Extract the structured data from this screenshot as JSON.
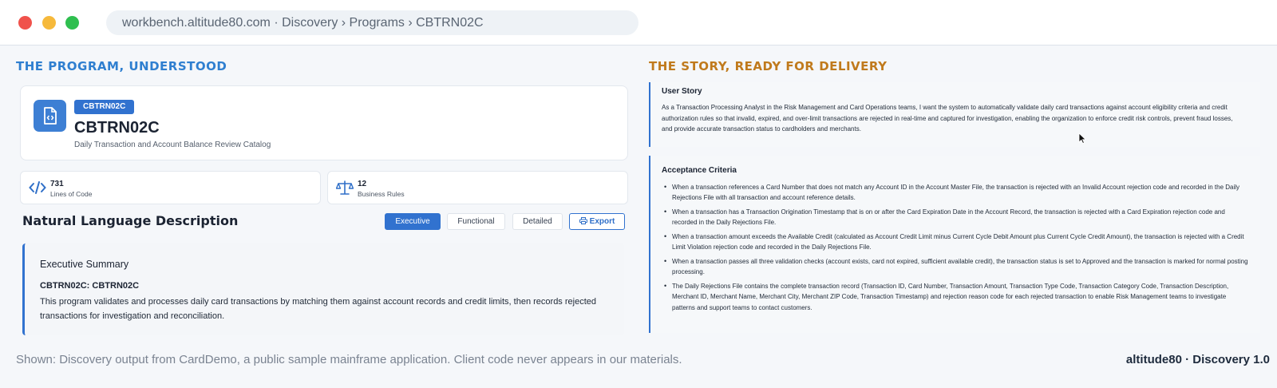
{
  "window": {
    "url_text": "workbench.altitude80.com  ·  Discovery › Programs › CBTRN02C"
  },
  "left": {
    "heading": "THE PROGRAM, UNDERSTOOD",
    "program": {
      "badge": "CBTRN02C",
      "title": "CBTRN02C",
      "subtitle": "Daily Transaction and Account Balance Review Catalog",
      "icon": "code-file-icon"
    },
    "stats": [
      {
        "value": "731",
        "label": "Lines of Code",
        "icon": "code-brackets-icon"
      },
      {
        "value": "12",
        "label": "Business Rules",
        "icon": "scales-icon"
      }
    ],
    "description": {
      "title": "Natural Language Description",
      "tabs": [
        "Executive",
        "Functional",
        "Detailed"
      ],
      "active_tab": "Executive",
      "export_label": "Export",
      "export_icon": "printer-icon",
      "summary_title": "Executive Summary",
      "summary_subtitle": "CBTRN02C: CBTRN02C",
      "summary_body": "This program validates and processes daily card transactions by matching them against account records and credit limits, then records rejected transactions for investigation and reconciliation."
    }
  },
  "right": {
    "heading": "THE STORY, READY FOR DELIVERY",
    "user_story": {
      "title": "User Story",
      "text": "As a Transaction Processing Analyst in the Risk Management and Card Operations teams, I want the system to automatically validate daily card transactions against account eligibility criteria and credit authorization rules so that invalid, expired, and over-limit transactions are rejected in real-time and captured for investigation, enabling the organization to enforce credit risk controls, prevent fraud losses, and provide accurate transaction status to cardholders and merchants."
    },
    "acceptance": {
      "title": "Acceptance Criteria",
      "items": [
        "When a transaction references a Card Number that does not match any Account ID in the Account Master File, the transaction is rejected with an Invalid Account rejection code and recorded in the Daily Rejections File with all transaction and account reference details.",
        "When a transaction has a Transaction Origination Timestamp that is on or after the Card Expiration Date in the Account Record, the transaction is rejected with a Card Expiration rejection code and recorded in the Daily Rejections File.",
        "When a transaction amount exceeds the Available Credit (calculated as Account Credit Limit minus Current Cycle Debit Amount plus Current Cycle Credit Amount), the transaction is rejected with a Credit Limit Violation rejection code and recorded in the Daily Rejections File.",
        "When a transaction passes all three validation checks (account exists, card not expired, sufficient available credit), the transaction status is set to Approved and the transaction is marked for normal posting processing.",
        "The Daily Rejections File contains the complete transaction record (Transaction ID, Card Number, Transaction Amount, Transaction Type Code, Transaction Category Code, Transaction Description, Merchant ID, Merchant Name, Merchant City, Merchant ZIP Code, Transaction Timestamp) and rejection reason code for each rejected transaction to enable Risk Management teams to investigate patterns and support teams to contact customers."
      ]
    }
  },
  "footer": {
    "note": "Shown: Discovery output from CardDemo, a public sample mainframe application. Client code never appears in our materials.",
    "brand": "altitude80 · Discovery 1.0"
  },
  "colors": {
    "accent_blue": "#3172cf",
    "heading_blue": "#2f7fd0",
    "heading_orange": "#c07a1c"
  }
}
